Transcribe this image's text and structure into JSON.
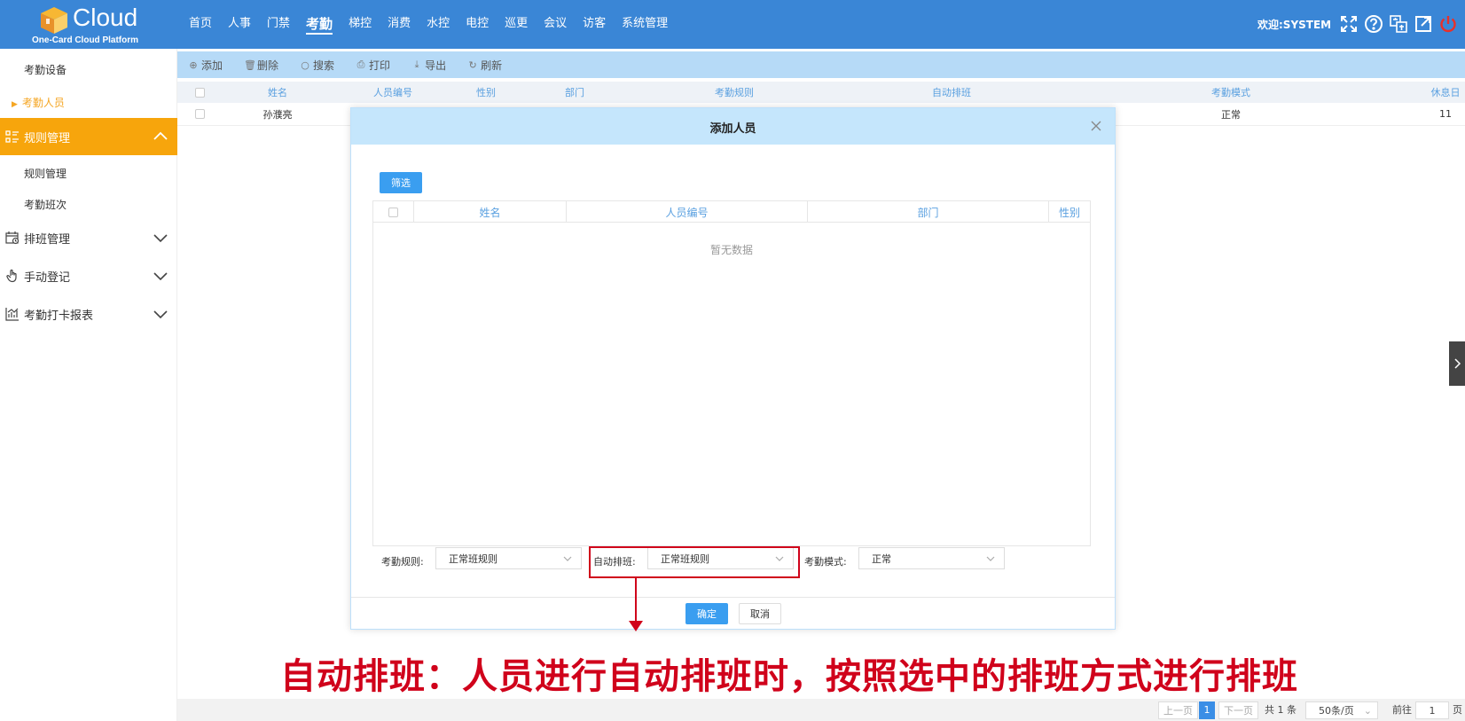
{
  "header": {
    "logo_word": "Cloud",
    "logo_sub": "One-Card Cloud Platform",
    "nav": [
      "首页",
      "人事",
      "门禁",
      "考勤",
      "梯控",
      "消费",
      "水控",
      "电控",
      "巡更",
      "会议",
      "访客",
      "系统管理"
    ],
    "active_nav": "考勤",
    "welcome": "欢迎:SYSTEM",
    "icons": [
      "fullscreen-icon",
      "help-icon",
      "language-icon",
      "external-link-icon",
      "power-icon"
    ]
  },
  "sidebar": {
    "items": {
      "attendance_device": "考勤设备",
      "attendance_staff": "考勤人员",
      "rule_management_group": "规则管理",
      "rule_management": "规则管理",
      "attendance_shift": "考勤班次",
      "schedule_management": "排班管理",
      "manual_register": "手动登记",
      "attendance_report": "考勤打卡报表"
    }
  },
  "toolbar": {
    "add": "添加",
    "delete": "删除",
    "search": "搜索",
    "print": "打印",
    "export": "导出",
    "refresh": "刷新"
  },
  "main_table": {
    "headers": [
      "姓名",
      "人员编号",
      "性别",
      "部门",
      "考勤规则",
      "自动排班",
      "考勤模式",
      "休息日"
    ],
    "rows": [
      {
        "name": "孙濮亮",
        "mode": "正常",
        "rest": "11"
      }
    ]
  },
  "pager": {
    "prev": "上一页",
    "current": "1",
    "next": "下一页",
    "total": "共 1 条",
    "page_size": "50条/页",
    "goto": "前往",
    "goto_value": "1",
    "page_unit": "页"
  },
  "modal": {
    "title": "添加人员",
    "filter": "筛选",
    "headers": [
      "姓名",
      "人员编号",
      "部门",
      "性别"
    ],
    "empty": "暂无数据",
    "rule_label": "考勤规则:",
    "rule_value": "正常班规则",
    "auto_label": "自动排班:",
    "auto_value": "正常班规则",
    "mode_label": "考勤模式:",
    "mode_value": "正常",
    "ok": "确定",
    "cancel": "取消"
  },
  "caption": "自动排班：人员进行自动排班时，按照选中的排班方式进行排班",
  "colors": {
    "header_blue": "#3a86d6",
    "sidebar_active": "#f7a50c",
    "annotation_red": "#d0021b",
    "primary_button": "#3a9ef0"
  }
}
